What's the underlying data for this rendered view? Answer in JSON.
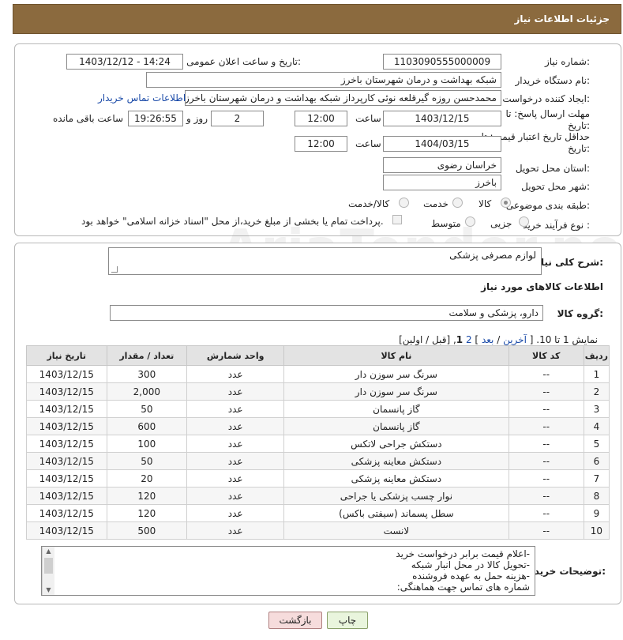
{
  "header": {
    "title": "جزئیات اطلاعات نیاز"
  },
  "watermark_text": "AriaTender.net",
  "form": {
    "need_number_label": "شماره نیاز:",
    "need_number": "1103090555000009",
    "announce_label": "تاریخ و ساعت اعلان عمومی:",
    "announce_value": "1403/12/12 - 14:24",
    "buyer_org_label": "نام دستگاه خریدار:",
    "buyer_org": "شبکه بهداشت و درمان شهرستان باخرز",
    "creator_label": "ایجاد کننده درخواست:",
    "creator": "محمدحسن روزه گیرقلعه نوئی کارپرداز شبکه بهداشت و درمان شهرستان باخرز",
    "buyer_contact_link": "اطلاعات تماس خریدار",
    "reply_deadline_label": "مهلت ارسال پاسخ: تا تاریخ:",
    "reply_date": "1403/12/15",
    "time_label": "ساعت",
    "reply_time": "12:00",
    "days_value": "2",
    "days_label": "روز و",
    "remaining_time": "19:26:55",
    "remaining_label": "ساعت باقی مانده",
    "price_validity_label": "حداقل تاریخ اعتبار قیمت: تا تاریخ:",
    "price_date": "1404/03/15",
    "price_time": "12:00",
    "province_label": "استان محل تحویل:",
    "province": "خراسان رضوی",
    "city_label": "شهر محل تحویل:",
    "city": "باخرز",
    "category_label": "طبقه بندی موضوعی:",
    "category_options": [
      "کالا",
      "خدمت",
      "کالا/خدمت"
    ],
    "category_selected": "کالا",
    "process_label": "نوع فرآیند خرید :",
    "process_options": [
      "جزیی",
      "متوسط"
    ],
    "payment_note": "پرداخت تمام یا بخشی از مبلغ خرید،از محل \"اسناد خزانه اسلامی\" خواهد بود."
  },
  "summary": {
    "label": "شرح کلی نیاز:",
    "value": "لوازم مصرفی پزشکی",
    "items_title": "اطلاعات کالاهای مورد نیاز",
    "group_label": "گروه کالا:",
    "group_value": "دارو، پزشکی و سلامت",
    "pager": {
      "prefix": "نمایش 1 تا 10. [",
      "last": "آخرین",
      "next": "بعد",
      "page2": "2",
      "page1": "1",
      "suffix": "[قبل / اولین]"
    }
  },
  "table": {
    "headers": [
      "ردیف",
      "کد کالا",
      "نام کالا",
      "واحد شمارش",
      "تعداد / مقدار",
      "تاریخ نیاز"
    ],
    "rows": [
      [
        "1",
        "--",
        "سرنگ سر سوزن دار",
        "عدد",
        "300",
        "1403/12/15"
      ],
      [
        "2",
        "--",
        "سرنگ سر سوزن دار",
        "عدد",
        "2,000",
        "1403/12/15"
      ],
      [
        "3",
        "--",
        "گاز پانسمان",
        "عدد",
        "50",
        "1403/12/15"
      ],
      [
        "4",
        "--",
        "گاز پانسمان",
        "عدد",
        "600",
        "1403/12/15"
      ],
      [
        "5",
        "--",
        "دستکش جراحی لاتکس",
        "عدد",
        "100",
        "1403/12/15"
      ],
      [
        "6",
        "--",
        "دستکش معاینه پزشکی",
        "عدد",
        "50",
        "1403/12/15"
      ],
      [
        "7",
        "--",
        "دستکش معاینه پزشکی",
        "عدد",
        "20",
        "1403/12/15"
      ],
      [
        "8",
        "--",
        "نوار چسب پزشکی یا جراحی",
        "عدد",
        "120",
        "1403/12/15"
      ],
      [
        "9",
        "--",
        "سطل پسماند (سیفتی باکس)",
        "عدد",
        "120",
        "1403/12/15"
      ],
      [
        "10",
        "--",
        "لانست",
        "عدد",
        "500",
        "1403/12/15"
      ]
    ]
  },
  "notes": {
    "label": "توضیحات خریدار:",
    "lines": [
      "-اعلام قیمت برابر درخواست خرید",
      "-تحویل کالا در محل انبار شبکه",
      "-هزینه حمل به عهده فروشنده",
      "شماره های تماس جهت هماهنگی:"
    ]
  },
  "buttons": {
    "print": "چاپ",
    "back": "بازگشت"
  }
}
